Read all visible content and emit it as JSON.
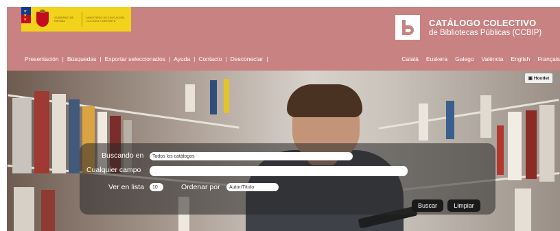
{
  "header": {
    "gov_logo": {
      "line1": "Gobierno de España",
      "line2": "Ministerio de Educación, Cultura y Deporte"
    },
    "catalog_title": "CATÁLOGO COLECTIVO",
    "catalog_subtitle": "de Bibliotecas Públicas (CCBIP)"
  },
  "nav": {
    "items": [
      "Presentación",
      "Búsquedas",
      "Exportar seleccionados",
      "Ayuda",
      "Contacto",
      "Desconectar"
    ]
  },
  "languages": [
    "Català",
    "Euskera",
    "Galego",
    "València",
    "English",
    "Français"
  ],
  "hero": {
    "hootlet_label": "Hootlet"
  },
  "search": {
    "buscando_en_label": "Buscando en",
    "buscando_en_value": "Todos los catálogos",
    "cualquier_campo_label": "Cualquier campo",
    "cualquier_campo_value": "",
    "ver_en_lista_label": "Ver en lista",
    "ver_en_lista_value": "10",
    "ordenar_por_label": "Ordenar por",
    "ordenar_por_value": "Autor/Título",
    "buscar_label": "Buscar",
    "limpiar_label": "Limpiar"
  },
  "colors": {
    "header_bg": "#c98282",
    "button_bg": "#1a1a1a"
  }
}
